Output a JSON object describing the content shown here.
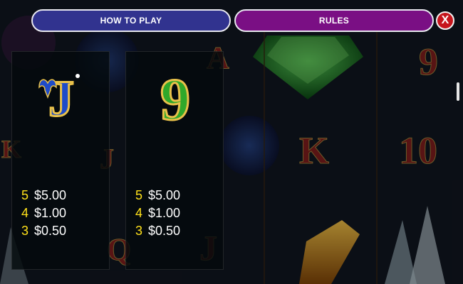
{
  "tabs": {
    "how_to_play": "HOW TO PLAY",
    "rules": "RULES"
  },
  "close_label": "X",
  "background_reel_symbols": [
    "K",
    "A",
    "9",
    "K",
    "10",
    "J",
    "Q",
    "J"
  ],
  "paytable": [
    {
      "symbol": "J",
      "payouts": [
        {
          "count": "5",
          "amount": "$5.00"
        },
        {
          "count": "4",
          "amount": "$1.00"
        },
        {
          "count": "3",
          "amount": "$0.50"
        }
      ]
    },
    {
      "symbol": "9",
      "payouts": [
        {
          "count": "5",
          "amount": "$5.00"
        },
        {
          "count": "4",
          "amount": "$1.00"
        },
        {
          "count": "3",
          "amount": "$0.50"
        }
      ]
    }
  ],
  "colors": {
    "how_to_play_tab": "#31338f",
    "rules_tab": "#7a0f84",
    "close_button": "#c6151c",
    "payout_count": "#ffe11a",
    "j_symbol": "#1e4bc8",
    "nine_symbol": "#2fa82a"
  }
}
